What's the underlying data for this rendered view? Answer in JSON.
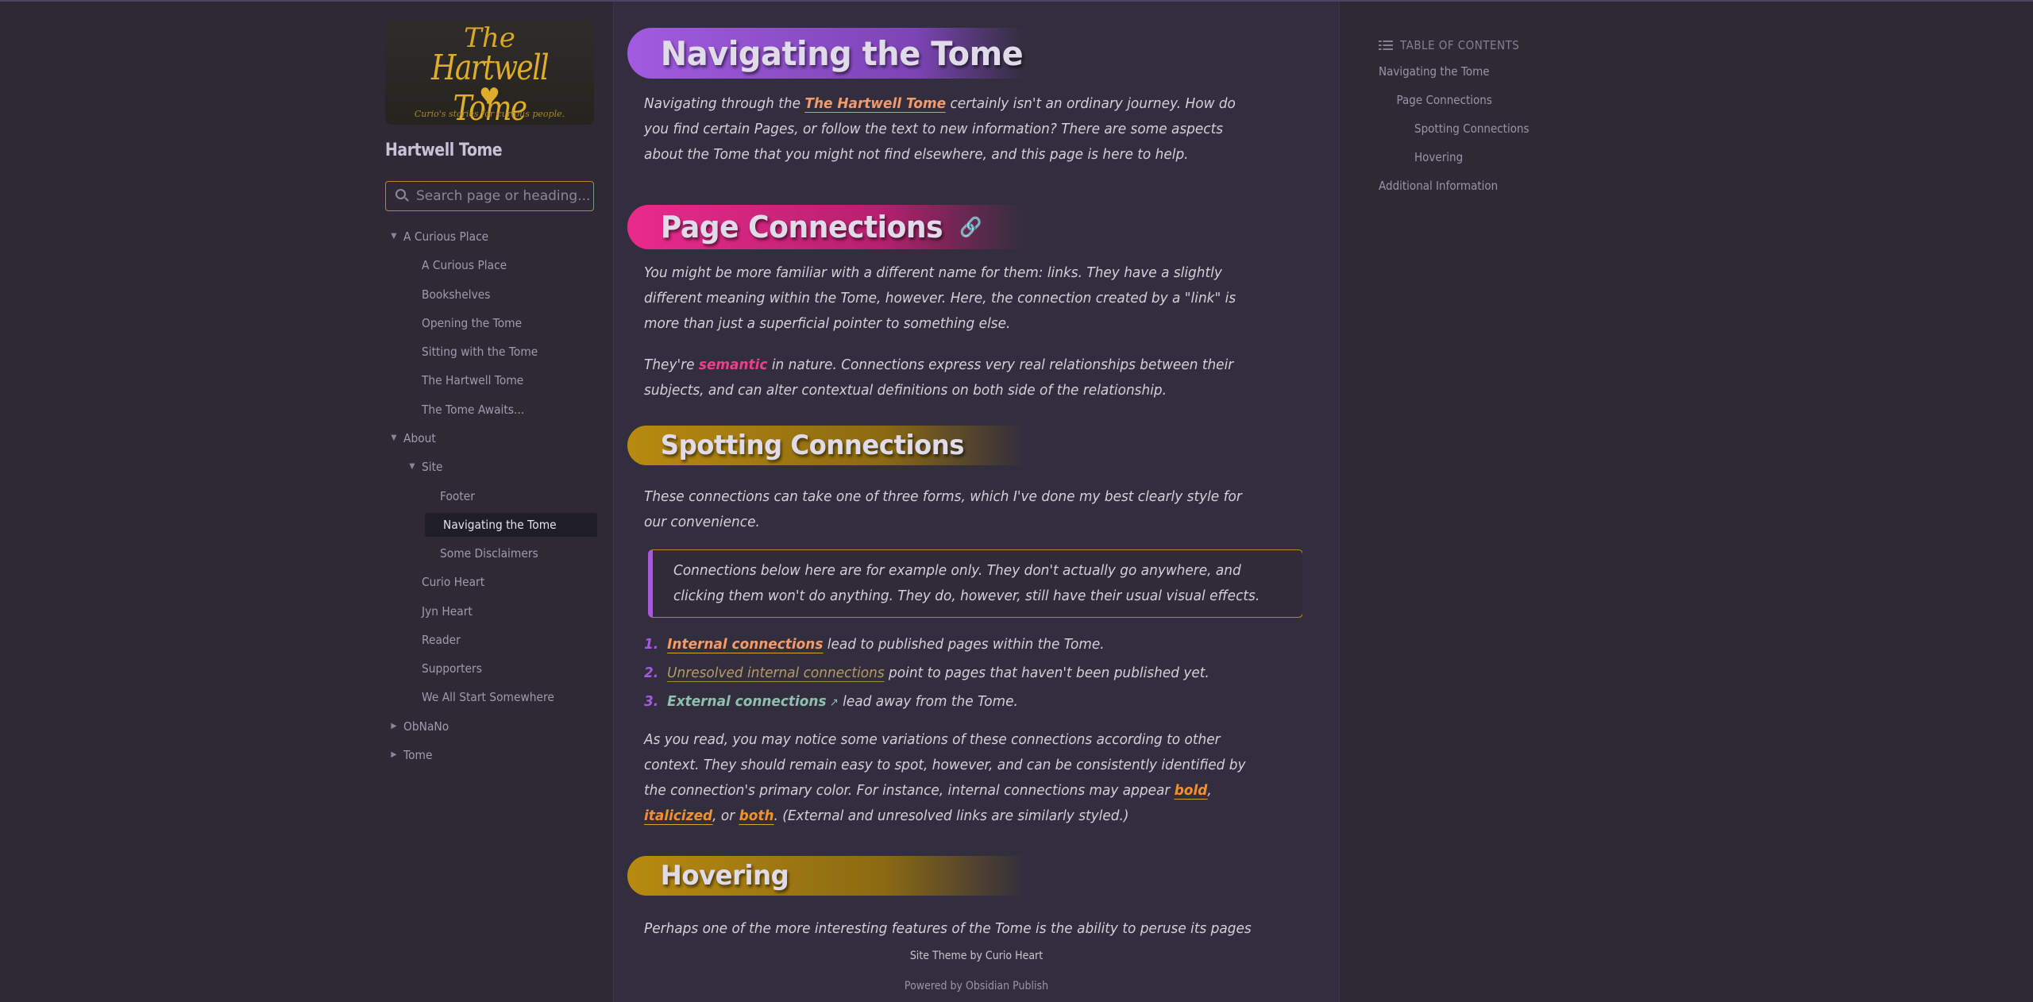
{
  "site": {
    "logo_top": "The",
    "logo_name": "Hartwell Tome",
    "logo_tagline": "Curio's stories for curious people.",
    "name": "Hartwell Tome"
  },
  "search": {
    "placeholder": "Search page or heading..."
  },
  "nav": {
    "items": [
      {
        "label": "A Curious Place",
        "level": 0,
        "arrow": "down"
      },
      {
        "label": "A Curious Place",
        "level": 1
      },
      {
        "label": "Bookshelves",
        "level": 1
      },
      {
        "label": "Opening the Tome",
        "level": 1
      },
      {
        "label": "Sitting with the Tome",
        "level": 1
      },
      {
        "label": "The Hartwell Tome",
        "level": 1
      },
      {
        "label": "The Tome Awaits...",
        "level": 1
      },
      {
        "label": "About",
        "level": 0,
        "arrow": "down"
      },
      {
        "label": "Site",
        "level": 1,
        "arrow": "down"
      },
      {
        "label": "Footer",
        "level": 2
      },
      {
        "label": "Navigating the Tome",
        "level": 2,
        "active": true
      },
      {
        "label": "Some Disclaimers",
        "level": 2
      },
      {
        "label": "Curio Heart",
        "level": 1
      },
      {
        "label": "Jyn Heart",
        "level": 1
      },
      {
        "label": "Reader",
        "level": 1
      },
      {
        "label": "Supporters",
        "level": 1
      },
      {
        "label": "We All Start Somewhere",
        "level": 1
      },
      {
        "label": "ObNaNo",
        "level": 0,
        "arrow": "right"
      },
      {
        "label": "Tome",
        "level": 0,
        "arrow": "right"
      }
    ]
  },
  "main": {
    "h1": "Navigating the Tome",
    "intro": {
      "a": "Navigating through the ",
      "link": "The Hartwell Tome",
      "b": " certainly isn't an ordinary journey. How do you find certain Pages, or follow the text to new information? There are some aspects about the Tome that you might not find elsewhere, and this page is here to help."
    },
    "h2": "Page Connections",
    "p_links": "You might be more familiar with a different name for them: links. They have a slightly different meaning within the Tome, however. Here, the connection created by a \"link\" is more than just a superficial pointer to something else.",
    "p_semantic": {
      "a": "They're ",
      "em": "semantic",
      "b": " in nature. Connections express very real relationships between their subjects, and can alter contextual definitions on both side of the relationship."
    },
    "h3_spotting": "Spotting Connections",
    "p_forms": "These connections can take one of three forms, which I've done my best clearly style for our convenience.",
    "callout": "Connections below here are for example only. They don't actually go anywhere, and clicking them won't do anything. They do, however, still have their usual visual effects.",
    "list": [
      {
        "num": "1.",
        "link": "Internal connections",
        "rest": " lead to published pages within the Tome."
      },
      {
        "num": "2.",
        "link": "Unresolved internal connections",
        "rest": " point to pages that haven't been published yet."
      },
      {
        "num": "3.",
        "link": "External connections",
        "rest": " lead away from the Tome."
      }
    ],
    "p_variations": {
      "a": "As you read, you may notice some variations of these connections according to other context. They should remain easy to spot, however, and can be consistently identified by the connection's primary color. For instance, internal connections may appear ",
      "bold": "bold",
      "sep1": ", ",
      "ital": "italicized",
      "sep2": ", or ",
      "both": "both",
      "b": ". (External and unresolved links are similarly styled.)"
    },
    "h3_hovering": "Hovering",
    "p_hover": "Perhaps one of the more interesting features of the Tome is the ability to peruse its pages"
  },
  "footer": {
    "theme": "Site Theme by Curio Heart",
    "powered_prefix": "Powered by ",
    "powered_link": "Obsidian Publish"
  },
  "toc": {
    "title": "TABLE OF CONTENTS",
    "items": [
      {
        "label": "Navigating the Tome",
        "level": 0
      },
      {
        "label": "Page Connections",
        "level": 1
      },
      {
        "label": "Spotting Connections",
        "level": 2
      },
      {
        "label": "Hovering",
        "level": 2
      },
      {
        "label": "Additional Information",
        "level": 0
      }
    ]
  },
  "colors": {
    "accent_purple": "#a25be0",
    "accent_pink": "#ea2a8c",
    "accent_gold": "#b88a10",
    "internal_link": "#f39a6a",
    "external_link": "#8fbfb0"
  }
}
